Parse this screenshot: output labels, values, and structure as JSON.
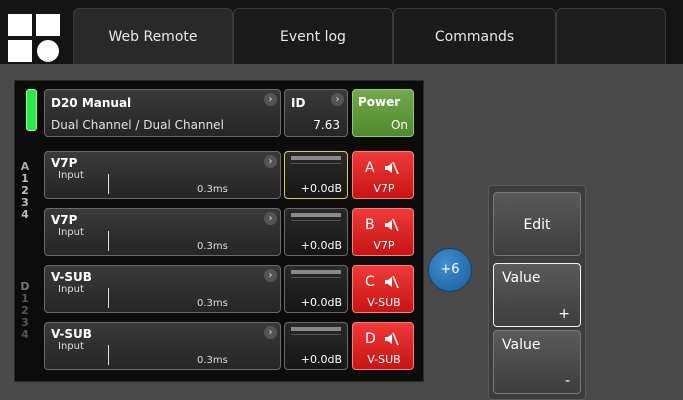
{
  "tabs": [
    "Web Remote",
    "Event log",
    "Commands"
  ],
  "device": {
    "name": "D20 Manual",
    "mode": "Dual Channel / Dual Channel",
    "id_label": "ID",
    "id_value": "7.63",
    "power_label": "Power",
    "power_state": "On"
  },
  "group_numbers": {
    "a": [
      "A",
      "1",
      "2",
      "3",
      "4"
    ],
    "d": [
      "D",
      "1",
      "2",
      "3",
      "4"
    ]
  },
  "channels": [
    {
      "name": "V7P",
      "input": "Input",
      "delay": "0.3ms",
      "gain": "+0.0dB",
      "letter": "A",
      "mute_name": "V7P"
    },
    {
      "name": "V7P",
      "input": "Input",
      "delay": "0.3ms",
      "gain": "+0.0dB",
      "letter": "B",
      "mute_name": "V7P"
    },
    {
      "name": "V-SUB",
      "input": "Input",
      "delay": "0.3ms",
      "gain": "+0.0dB",
      "letter": "C",
      "mute_name": "V-SUB"
    },
    {
      "name": "V-SUB",
      "input": "Input",
      "delay": "0.3ms",
      "gain": "+0.0dB",
      "letter": "D",
      "mute_name": "V-SUB"
    }
  ],
  "badge": "+6",
  "right_panel": {
    "edit": "Edit",
    "value_up_label": "Value",
    "value_up_sign": "+",
    "value_down_label": "Value",
    "value_down_sign": "-"
  },
  "colors": {
    "power_green": "#5f9a3a",
    "mute_red": "#dc2222",
    "led_green": "#2ee84a",
    "badge_blue": "#2a70b4",
    "selected_outline": "#d8d23a"
  }
}
